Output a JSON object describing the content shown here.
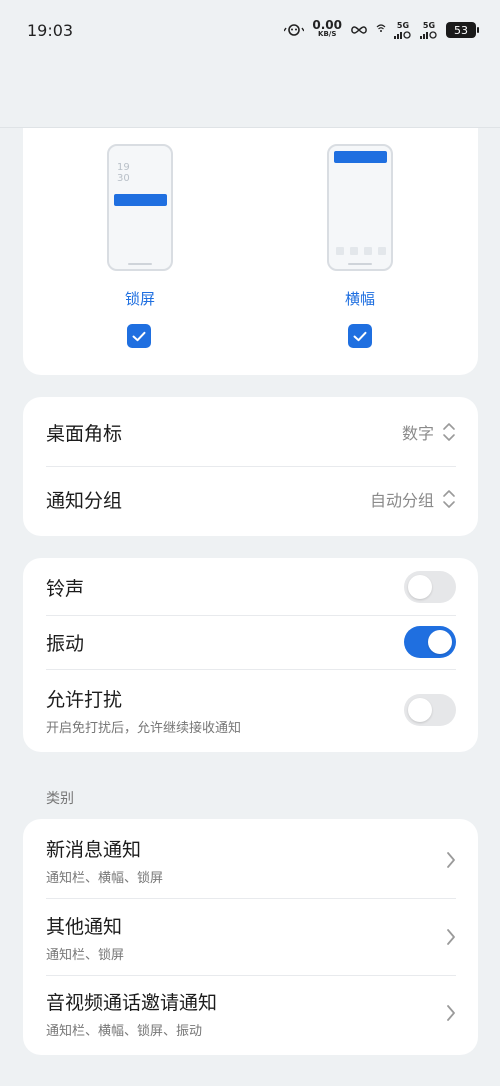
{
  "status_bar": {
    "time": "19:03",
    "speed_value": "0.00",
    "speed_unit": "KB/S",
    "sim1": "5G",
    "sim2": "5G",
    "battery": "53"
  },
  "notification_style": {
    "lock_clock_hour": "19",
    "lock_clock_min": "30",
    "lock_label": "锁屏",
    "lock_checked": true,
    "banner_label": "横幅",
    "banner_checked": true
  },
  "settings": {
    "badge_title": "桌面角标",
    "badge_value": "数字",
    "group_title": "通知分组",
    "group_value": "自动分组"
  },
  "toggles": {
    "ringtone_title": "铃声",
    "ringtone_on": false,
    "vibrate_title": "振动",
    "vibrate_on": true,
    "dnd_title": "允许打扰",
    "dnd_sub": "开启免打扰后，允许继续接收通知",
    "dnd_on": false
  },
  "category": {
    "section_label": "类别",
    "items": [
      {
        "title": "新消息通知",
        "sub": "通知栏、横幅、锁屏"
      },
      {
        "title": "其他通知",
        "sub": "通知栏、锁屏"
      },
      {
        "title": "音视频通话邀请通知",
        "sub": "通知栏、横幅、锁屏、振动"
      }
    ]
  },
  "colors": {
    "accent": "#1f6fe0",
    "background": "#eef1f3",
    "card": "#ffffff"
  }
}
